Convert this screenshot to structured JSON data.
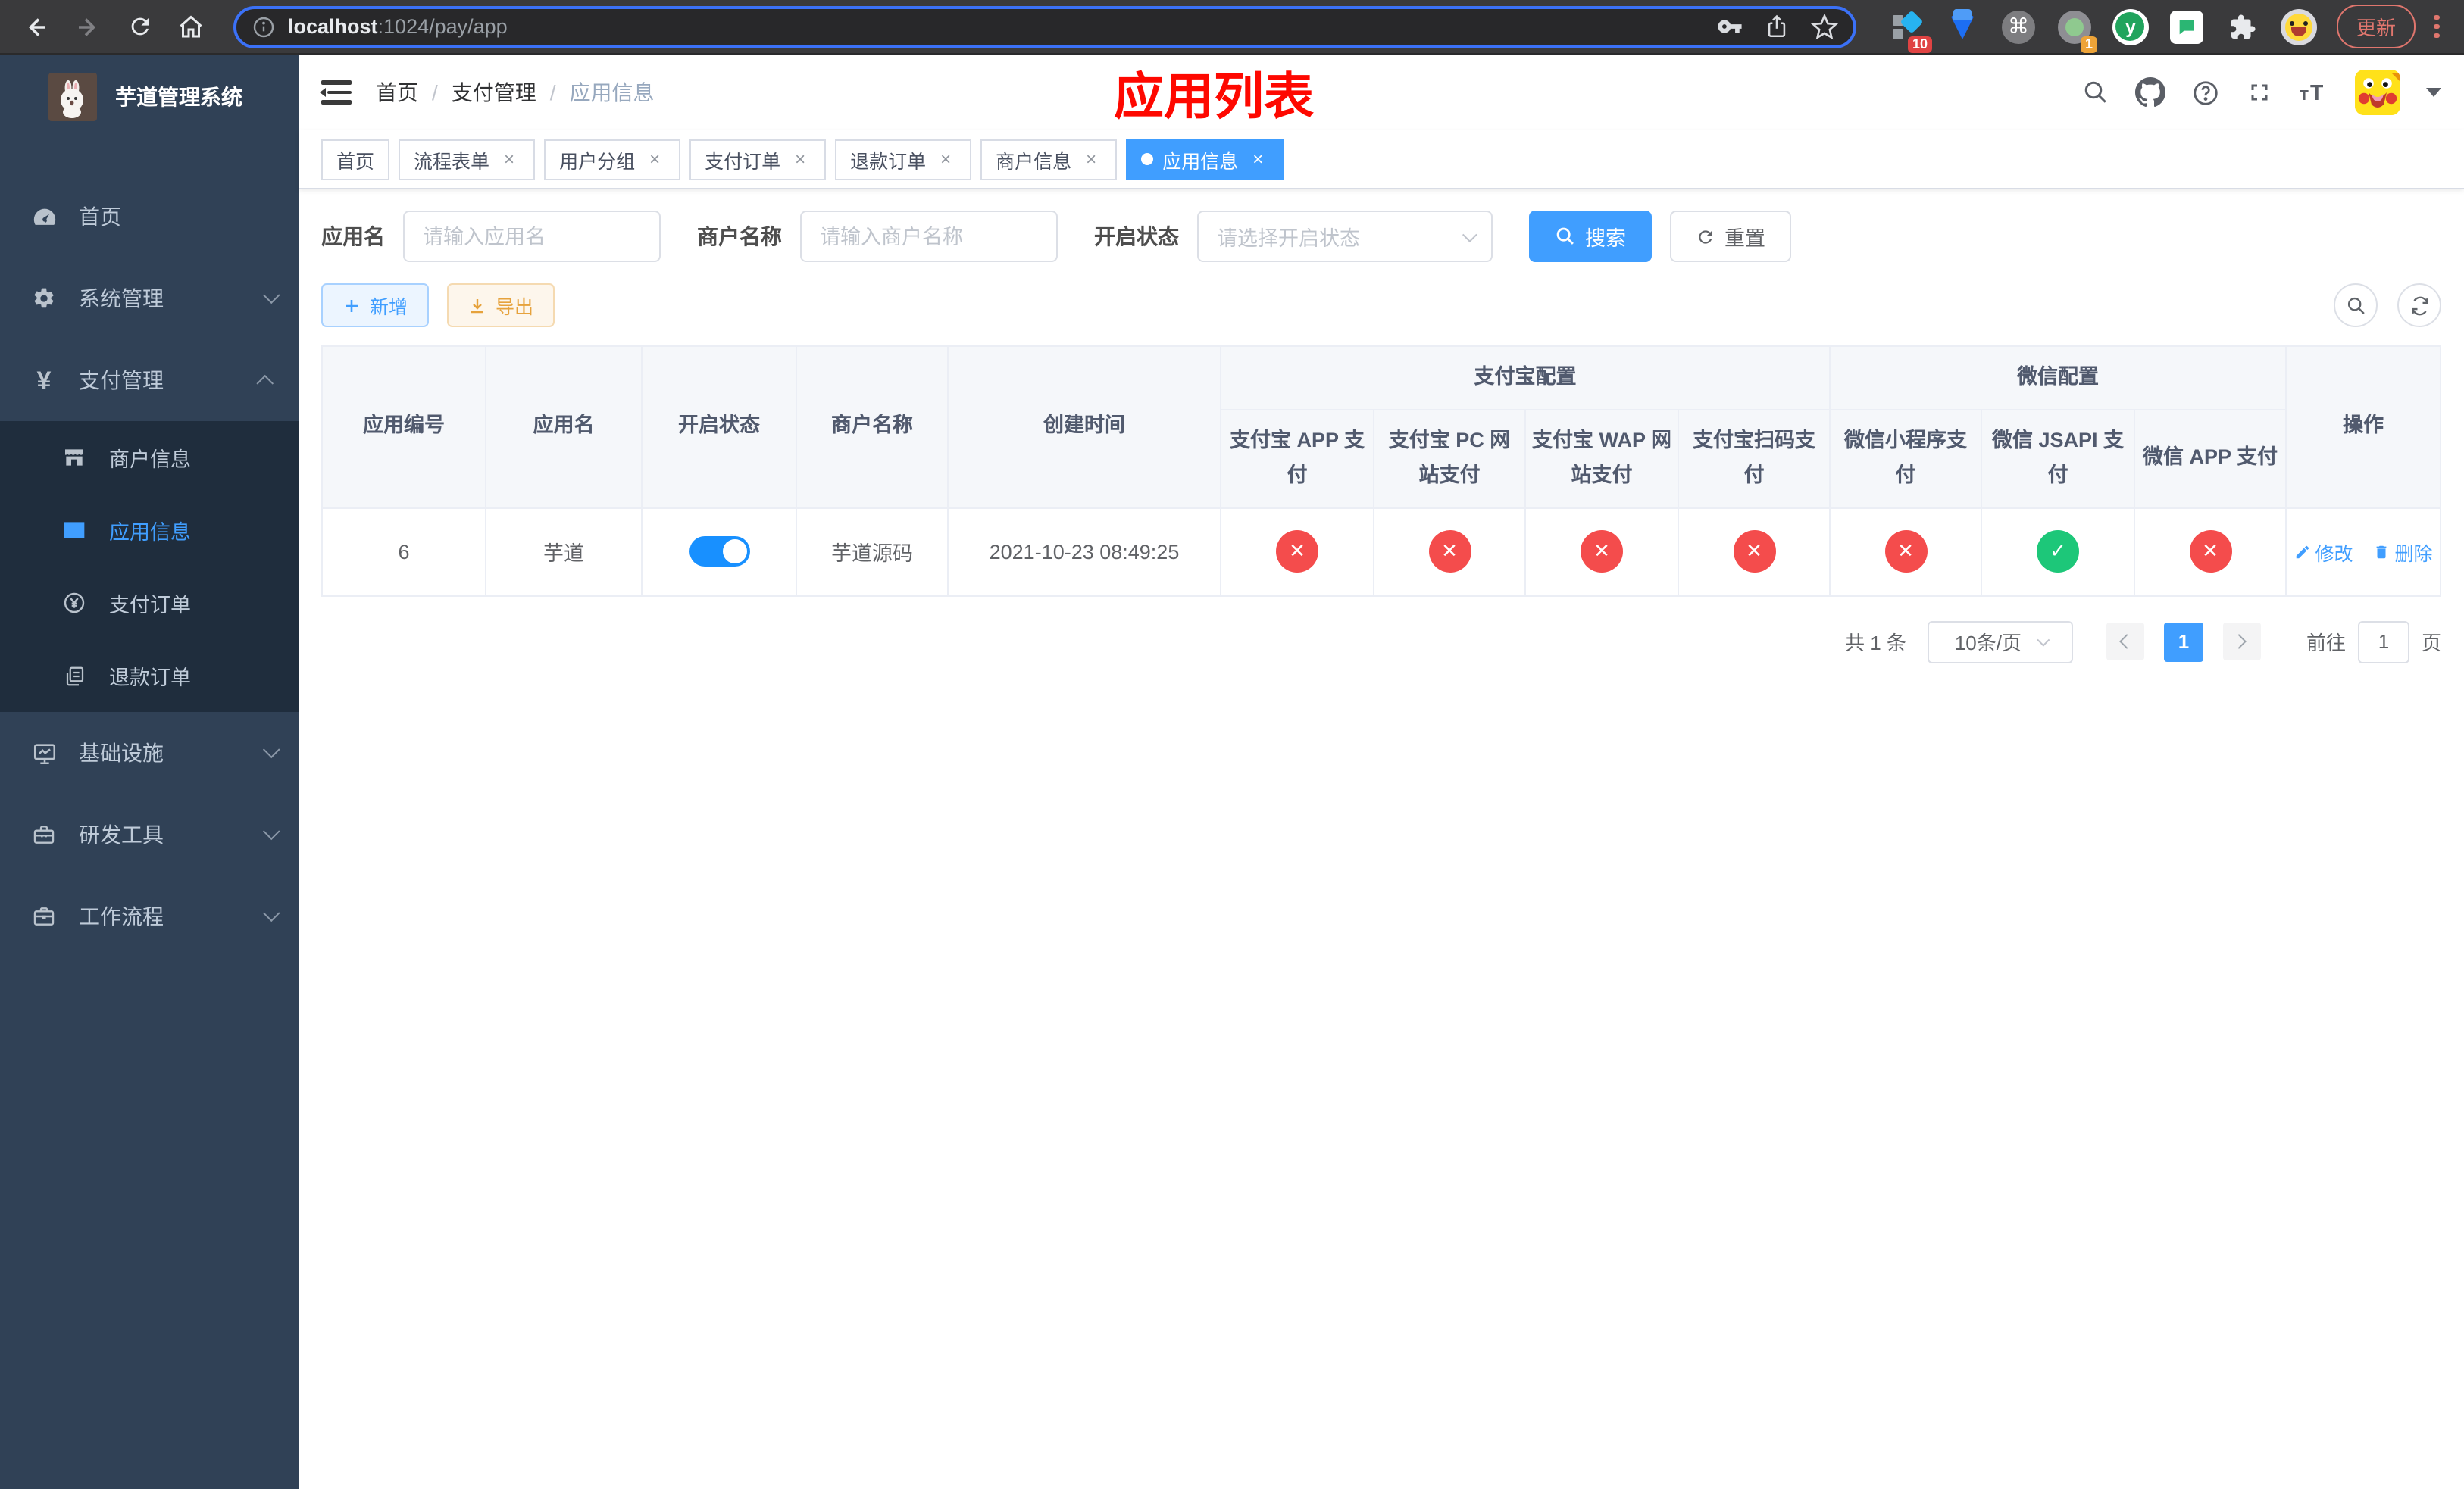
{
  "colors": {
    "accent": "#409eff",
    "switch_on": "#1890ff",
    "danger": "#f44c4c",
    "success": "#1dc779",
    "warning": "#e6a23c",
    "annotation": "#fe0800",
    "sidebar_bg": "#304156",
    "sidebar_sub_bg": "#1f2d3d",
    "sidebar_text": "#bfcbd9"
  },
  "icons": {
    "check": "✓",
    "cross": "✕",
    "tab_close": "×",
    "command": "⌘",
    "yen": "¥",
    "question": "?",
    "y_logo": "y"
  },
  "browser": {
    "url_host": "localhost",
    "url_path": ":1024/pay/app",
    "ext_badge_blue_diamond": "10",
    "ext_badge_camera": "1",
    "update_button": "更新"
  },
  "sidebar": {
    "app_title": "芋道管理系统",
    "items": [
      {
        "label": "首页"
      },
      {
        "label": "系统管理"
      },
      {
        "label": "支付管理"
      },
      {
        "label": "商户信息"
      },
      {
        "label": "应用信息"
      },
      {
        "label": "支付订单"
      },
      {
        "label": "退款订单"
      },
      {
        "label": "基础设施"
      },
      {
        "label": "研发工具"
      },
      {
        "label": "工作流程"
      }
    ]
  },
  "breadcrumb": {
    "items": [
      "首页",
      "支付管理",
      "应用信息"
    ],
    "separator": "/"
  },
  "annotation": {
    "title": "应用列表"
  },
  "tabs": [
    {
      "label": "首页"
    },
    {
      "label": "流程表单"
    },
    {
      "label": "用户分组"
    },
    {
      "label": "支付订单"
    },
    {
      "label": "退款订单"
    },
    {
      "label": "商户信息"
    },
    {
      "label": "应用信息"
    }
  ],
  "filters": {
    "app_name_label": "应用名",
    "app_name_placeholder": "请输入应用名",
    "merchant_label": "商户名称",
    "merchant_placeholder": "请输入商户名称",
    "status_label": "开启状态",
    "status_placeholder": "请选择开启状态",
    "search_button": "搜索",
    "reset_button": "重置"
  },
  "toolbar": {
    "add_button": "新增",
    "export_button": "导出"
  },
  "table": {
    "columns": [
      "应用编号",
      "应用名",
      "开启状态",
      "商户名称",
      "创建时间"
    ],
    "group_alipay": "支付宝配置",
    "group_wechat": "微信配置",
    "alipay_columns": [
      "支付宝 APP 支付",
      "支付宝 PC 网站支付",
      "支付宝 WAP 网站支付",
      "支付宝扫码支付"
    ],
    "wechat_columns": [
      "微信小程序支付",
      "微信 JSAPI 支付",
      "微信 APP 支付"
    ],
    "actions_column": "操作",
    "row": {
      "id": "6",
      "name": "芋道",
      "enabled": true,
      "merchant": "芋道源码",
      "created_at": "2021-10-23 08:49:25",
      "channel_status": [
        "no",
        "no",
        "no",
        "no",
        "no",
        "yes",
        "no"
      ],
      "edit_label": "修改",
      "delete_label": "删除"
    }
  },
  "pagination": {
    "total_text": "共 1 条",
    "page_size": "10条/页",
    "current_page": "1",
    "goto_label": "前往",
    "goto_value": "1",
    "page_label": "页"
  }
}
